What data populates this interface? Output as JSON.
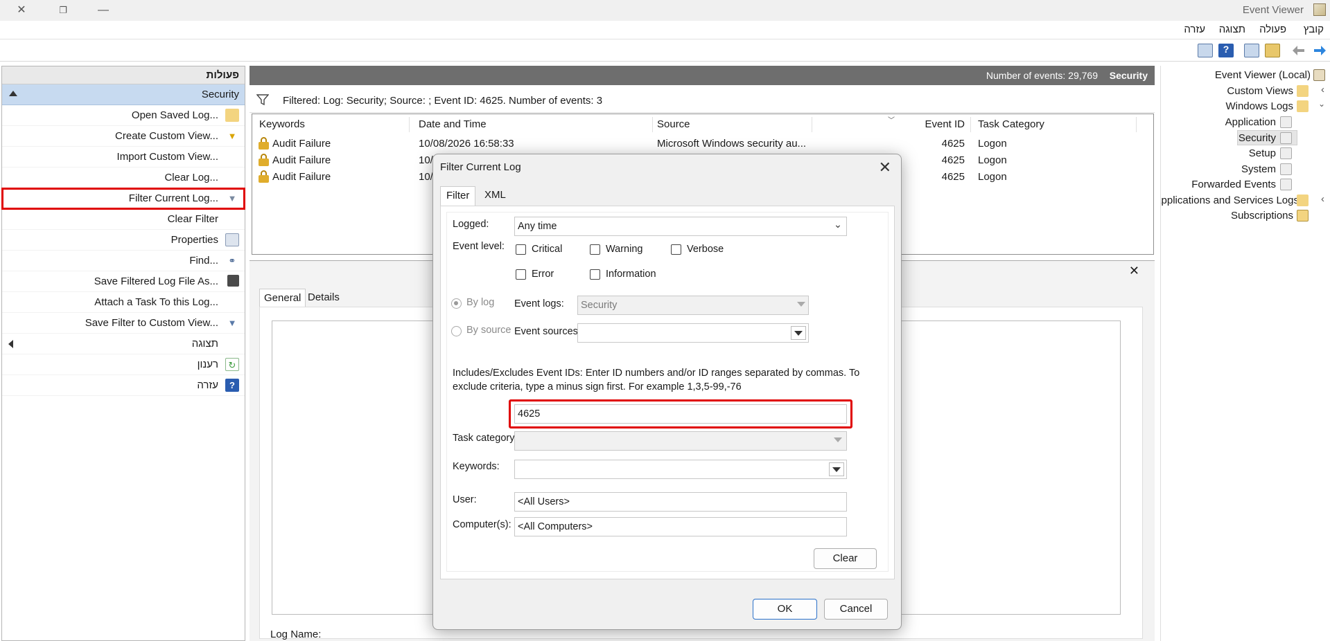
{
  "window": {
    "title": "Event Viewer"
  },
  "menu": [
    "קובץ",
    "פעולה",
    "תצוגה",
    "עזרה"
  ],
  "actions_pane": {
    "header": "פעולות",
    "section": "Security",
    "items": [
      "Open Saved Log...",
      "Create Custom View...",
      "Import Custom View...",
      "Clear Log...",
      "Filter Current Log...",
      "Clear Filter",
      "Properties",
      "Find...",
      "Save Filtered Log File As...",
      "Attach a Task To this Log...",
      "Save Filter to Custom View..."
    ],
    "view_group": "תצוגה",
    "refresh": "רענון",
    "help": "עזרה"
  },
  "center": {
    "log_name": "Security",
    "event_count": "Number of events: 29,769",
    "filter_text": "Filtered: Log: Security; Source: ; Event ID: 4625. Number of events: 3",
    "columns": [
      "Keywords",
      "Date and Time",
      "Source",
      "Event ID",
      "Task Category"
    ],
    "rows": [
      {
        "keywords": "Audit Failure",
        "date": "10/08/2026 16:58:33",
        "source": "Microsoft Windows security au...",
        "event_id": "4625",
        "category": "Logon"
      },
      {
        "keywords": "Audit Failure",
        "date": "10/",
        "source": "",
        "event_id": "4625",
        "category": "Logon"
      },
      {
        "keywords": "Audit Failure",
        "date": "10/",
        "source": "",
        "event_id": "4625",
        "category": "Logon"
      }
    ],
    "detail_tabs": [
      "General",
      "Details"
    ],
    "log_name_label": "Log Name:"
  },
  "tree": {
    "items": [
      "Event Viewer (Local)",
      "Custom Views",
      "Windows Logs",
      "Application",
      "Security",
      "Setup",
      "System",
      "Forwarded Events",
      "Applications and Services Logs",
      "Subscriptions"
    ]
  },
  "dialog": {
    "title": "Filter Current Log",
    "tabs": [
      "Filter",
      "XML"
    ],
    "logged_label": "Logged:",
    "logged_value": "Any time",
    "event_level_label": "Event level:",
    "levels": [
      "Critical",
      "Warning",
      "Verbose",
      "Error",
      "Information"
    ],
    "by_log_label": "By log",
    "by_source_label": "By source",
    "event_logs_label": "Event logs:",
    "event_logs_value": "Security",
    "event_sources_label": "Event sources:",
    "event_sources_value": "",
    "includes_text_1": "Includes/Excludes Event IDs: Enter ID numbers and/or ID ranges separated by commas. To",
    "includes_text_2": "exclude criteria, type a minus sign first. For example 1,3,5-99,-76",
    "event_id_value": "4625",
    "task_category_label": "Task category:",
    "keywords_label": "Keywords:",
    "user_label": "User:",
    "user_value": "<All Users>",
    "computers_label": "Computer(s):",
    "computers_value": "<All Computers>",
    "clear_button": "Clear",
    "ok_button": "OK",
    "cancel_button": "Cancel"
  },
  "colors": {
    "highlight": "#e00000",
    "section_bg": "#c7daf0",
    "header_gray": "#6e6e6e",
    "ok_border": "#2a70c9"
  }
}
